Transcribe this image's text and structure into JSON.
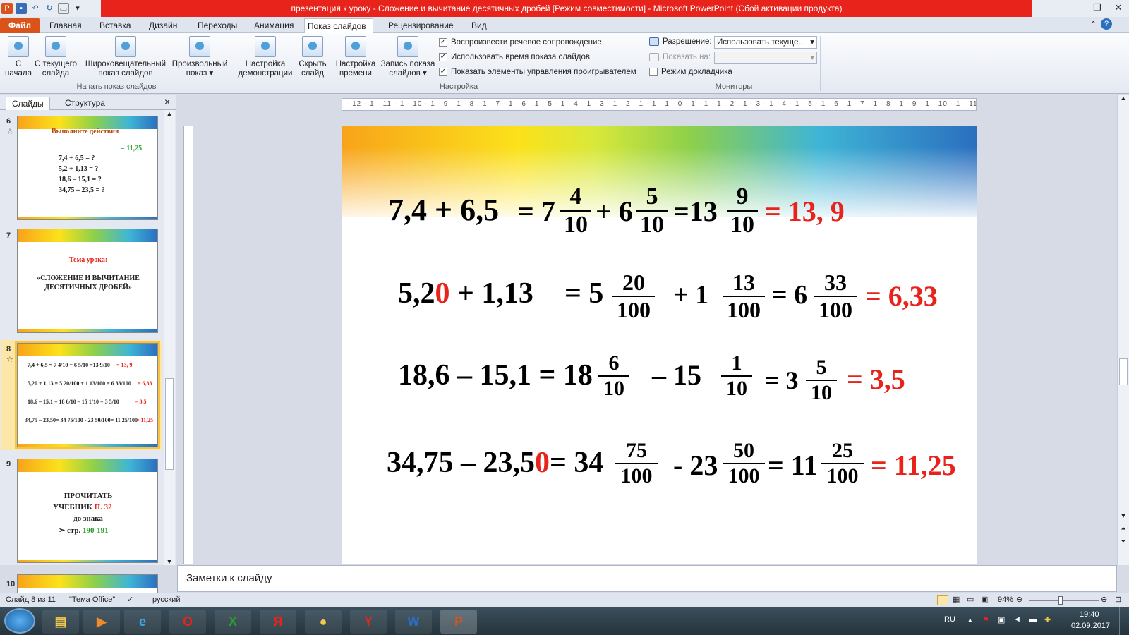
{
  "window": {
    "title": "презентация к уроку - Сложение и вычитание десятичных дробей [Режим совместимости]  -  Microsoft PowerPoint (Сбой активации продукта)"
  },
  "ribbon": {
    "file_tab": "Файл",
    "tabs": [
      "Главная",
      "Вставка",
      "Дизайн",
      "Переходы",
      "Анимация",
      "Показ слайдов",
      "Рецензирование",
      "Вид"
    ],
    "active_tab": "Показ слайдов",
    "group_start": {
      "label": "Начать показ слайдов",
      "btn_from_start": [
        "С",
        "начала"
      ],
      "btn_from_current": [
        "С текущего",
        "слайда"
      ],
      "btn_broadcast": [
        "Широковещательный",
        "показ слайдов"
      ],
      "btn_custom": [
        "Произвольный",
        "показ ▾"
      ]
    },
    "group_setup": {
      "label": "Настройка",
      "btn_setup": [
        "Настройка",
        "демонстрации"
      ],
      "btn_hide": [
        "Скрыть",
        "слайд"
      ],
      "btn_rehearse": [
        "Настройка",
        "времени"
      ],
      "btn_record": [
        "Запись показа",
        "слайдов ▾"
      ],
      "chk_narration": "Воспроизвести речевое сопровождение",
      "chk_timings": "Использовать время показа слайдов",
      "chk_controls": "Показать элементы управления проигрывателем"
    },
    "group_monitors": {
      "label": "Мониторы",
      "resolution_label": "Разрешение:",
      "resolution_value": "Использовать текуще...",
      "show_on_label": "Показать на:",
      "presenter_view": "Режим докладчика"
    }
  },
  "left_pane": {
    "tab_slides": "Слайды",
    "tab_outline": "Структура",
    "close": "×",
    "thumbs": {
      "s6": {
        "num": "6",
        "title": "Выполните действия",
        "l1": "7,4 + 6,5 = ?",
        "l2": "5,2 + 1,13 = ?",
        "l3": "18,6 – 15,1 = ?",
        "l4": "34,75 – 23,5 = ?",
        "green": "= 11,25"
      },
      "s7": {
        "num": "7",
        "title": "Тема урока:",
        "l1": "«СЛОЖЕНИЕ И ВЫЧИТАНИЕ",
        "l2": "ДЕСЯТИЧНЫХ ДРОБЕЙ»"
      },
      "s8": {
        "num": "8",
        "r1": "7,4 + 6,5  = 7 4/10 + 6 5/10 =13 9/10",
        "r1red": "= 13, 9",
        "r2": "5,20 + 1,13 = 5 20/100 + 1 13/100 = 6 33/100",
        "r2red": "= 6,33",
        "r3": "18,6 – 15,1 = 18 6/10 – 15 1/10 = 3 5/10",
        "r3red": "= 3,5",
        "r4": "34,75 – 23,50= 34 75/100 - 23 50/100= 11 25/100",
        "r4red": "= 11,25"
      },
      "s9": {
        "num": "9",
        "l1": "ПРОЧИТАТЬ",
        "l2a": "УЧЕБНИК ",
        "l2b": "П. 32",
        "l3": "до знака",
        "l4a": "➢ стр. ",
        "l4b": "190-191"
      },
      "s10": {
        "num": "10"
      }
    }
  },
  "ruler": {
    "h": "· 12 · 1 · 11 · 1 · 10 · 1 · 9 · 1 · 8 · 1 · 7 · 1 · 6 · 1 · 5 · 1 · 4 · 1 · 3 · 1 · 2 · 1 · 1 · 1 · 0 · 1 · 1 · 1 · 2 · 1 · 3 · 1 · 4 · 1 · 5 · 1 · 6 · 1 · 7 · 1 · 8 · 1 · 9 · 1 · 10 · 1 · 11 · 1 · 12 ·"
  },
  "slide": {
    "row1": {
      "lhs": "7,4 + 6,5",
      "eq1": "= 7",
      "f1n": "4",
      "f1d": "10",
      "plus": "+ 6",
      "f2n": "5",
      "f2d": "10",
      "eq2": "=13",
      "f3n": "9",
      "f3d": "10",
      "result": "= 13, 9"
    },
    "row2": {
      "lhs_a": "5,2",
      "lhs_red": "0",
      "lhs_b": " + 1,13",
      "eq1": "= 5",
      "f1n": "20",
      "f1d": "100",
      "plus": "+  1",
      "f2n": "13",
      "f2d": "100",
      "eq2": "= 6",
      "f3n": "33",
      "f3d": "100",
      "result": "= 6,33"
    },
    "row3": {
      "lhs": "18,6 – 15,1 = 18",
      "f1n": "6",
      "f1d": "10",
      "minus": "– 15",
      "f2n": "1",
      "f2d": "10",
      "eq2": "= 3",
      "f3n": "5",
      "f3d": "10",
      "result": "= 3,5"
    },
    "row4": {
      "lhs_a": "34,75 – 23,5",
      "lhs_red": "0",
      "lhs_b": "= 34",
      "f1n": "75",
      "f1d": "100",
      "minus": "- 23",
      "f2n": "50",
      "f2d": "100",
      "eq2": "= 11",
      "f3n": "25",
      "f3d": "100",
      "result": "= 11,25"
    }
  },
  "notes": {
    "placeholder": "Заметки к слайду"
  },
  "status": {
    "slide_of": "Слайд 8 из 11",
    "theme": "\"Тема Office\"",
    "language": "русский",
    "zoom": "94%"
  },
  "taskbar": {
    "lang": "RU",
    "time": "19:40",
    "date": "02.09.2017"
  },
  "colors": {
    "accent_red": "#e8231b",
    "file_tab": "#d9531a",
    "green": "#2aa02a"
  }
}
